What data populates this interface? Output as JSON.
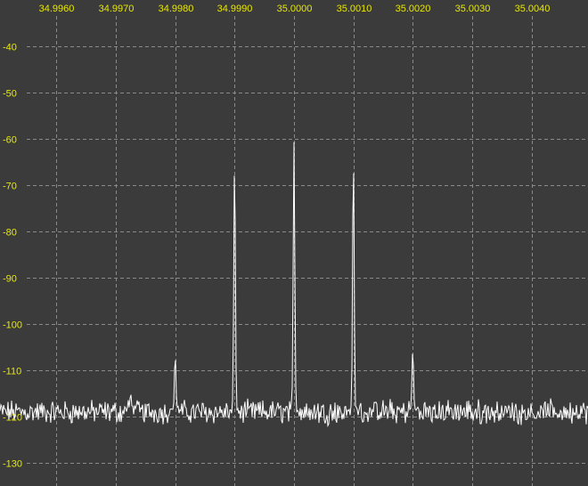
{
  "colors": {
    "background": "#3b3b3b",
    "grid": "#8a8a8a",
    "tick_label": "#e8e800",
    "trace": "#ffffff"
  },
  "chart_data": {
    "type": "line",
    "title": "",
    "xlabel": "",
    "ylabel": "",
    "xlim": [
      34.99505,
      35.00495
    ],
    "ylim": [
      -135,
      -30
    ],
    "grid": true,
    "x_ticks": [
      34.996,
      34.997,
      34.998,
      34.999,
      35.0,
      35.001,
      35.002,
      35.003,
      35.004
    ],
    "x_tick_labels": [
      "34.9960",
      "34.9970",
      "34.9980",
      "34.9990",
      "35.0000",
      "35.0010",
      "35.0020",
      "35.0030",
      "35.0040"
    ],
    "y_ticks": [
      -40,
      -50,
      -60,
      -70,
      -80,
      -90,
      -100,
      -110,
      -120,
      -130
    ],
    "y_tick_labels": [
      "-40",
      "-50",
      "-60",
      "-70",
      "-80",
      "-90",
      "-100",
      "-110",
      "-120",
      "-130"
    ],
    "noise_floor": -119,
    "noise_amplitude": 2,
    "peaks": [
      {
        "x": 34.99725,
        "y": -115
      },
      {
        "x": 34.998,
        "y": -107
      },
      {
        "x": 34.999,
        "y": -64
      },
      {
        "x": 35.0,
        "y": -60
      },
      {
        "x": 35.001,
        "y": -64
      },
      {
        "x": 35.002,
        "y": -105.5
      }
    ]
  }
}
